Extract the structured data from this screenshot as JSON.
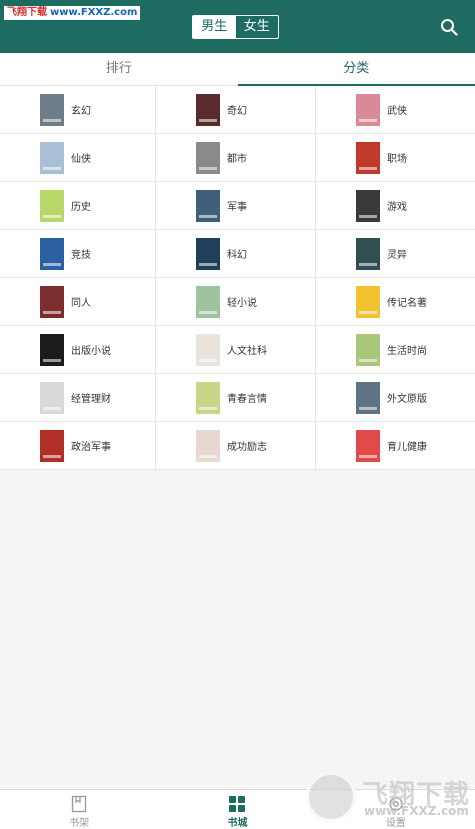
{
  "watermark_top": {
    "cn": "飞翔下载",
    "url": "www.FXXZ.com"
  },
  "header": {
    "gender_tabs": [
      {
        "label": "男生",
        "active": true
      },
      {
        "label": "女生",
        "active": false
      }
    ],
    "search_icon": "search-icon"
  },
  "tabs": [
    {
      "label": "排行",
      "active": false
    },
    {
      "label": "分类",
      "active": true
    }
  ],
  "categories": [
    {
      "label": "玄幻",
      "color": "#6f7d88"
    },
    {
      "label": "奇幻",
      "color": "#5a2a2e"
    },
    {
      "label": "武侠",
      "color": "#d98a99"
    },
    {
      "label": "仙侠",
      "color": "#a9bfd8"
    },
    {
      "label": "都市",
      "color": "#8a8a8a"
    },
    {
      "label": "职场",
      "color": "#c0392b"
    },
    {
      "label": "历史",
      "color": "#b8d96a"
    },
    {
      "label": "军事",
      "color": "#3f5e7a"
    },
    {
      "label": "游戏",
      "color": "#3a3a3a"
    },
    {
      "label": "竞技",
      "color": "#2d5fa3"
    },
    {
      "label": "科幻",
      "color": "#1f3f5a"
    },
    {
      "label": "灵异",
      "color": "#2f4f52"
    },
    {
      "label": "同人",
      "color": "#7b2d2d"
    },
    {
      "label": "轻小说",
      "color": "#9fc3a0"
    },
    {
      "label": "传记名著",
      "color": "#f2c232"
    },
    {
      "label": "出版小说",
      "color": "#1c1c1c"
    },
    {
      "label": "人文社科",
      "color": "#e8e4dc"
    },
    {
      "label": "生活时尚",
      "color": "#a9c77a"
    },
    {
      "label": "经管理财",
      "color": "#d9d9d9"
    },
    {
      "label": "青春言情",
      "color": "#c9d68a"
    },
    {
      "label": "外文原版",
      "color": "#5e7385"
    },
    {
      "label": "政治军事",
      "color": "#b03028"
    },
    {
      "label": "成功励志",
      "color": "#e9d7d2"
    },
    {
      "label": "育儿健康",
      "color": "#e04a4a"
    }
  ],
  "bottom_nav": [
    {
      "label": "书架",
      "icon": "book-icon",
      "active": false
    },
    {
      "label": "书城",
      "icon": "grid-icon",
      "active": true
    },
    {
      "label": "设置",
      "icon": "gear-icon",
      "active": false
    }
  ],
  "watermark_bottom": {
    "text": "飞翔下载",
    "url": "www.FXXZ.com"
  },
  "colors": {
    "brand": "#1e6b62",
    "background": "#f5f5f5"
  }
}
